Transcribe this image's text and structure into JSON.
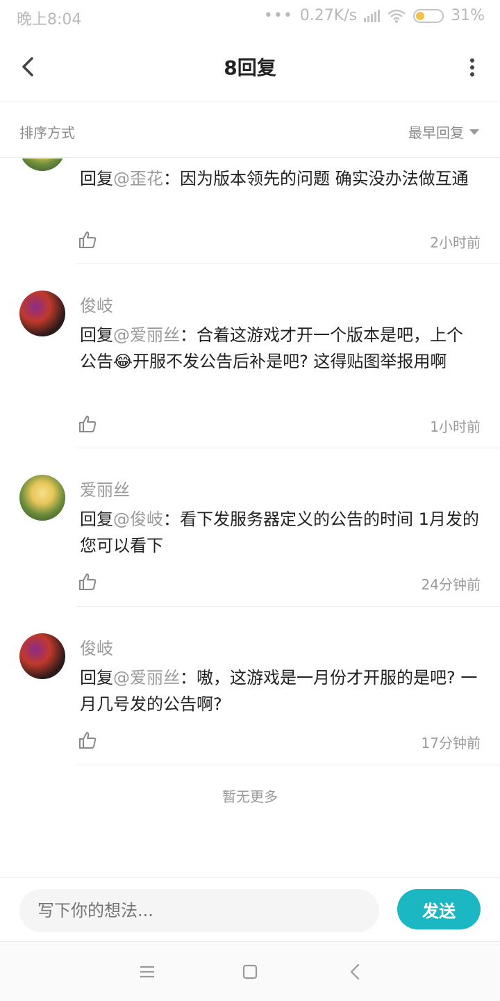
{
  "status_bar": {
    "time": "晚上8:04",
    "network_speed": "0.27K/s",
    "battery_percent": "31%",
    "battery_level": 0.31,
    "icons": [
      "dots-icon",
      "signal-icon",
      "wifi-icon",
      "battery-icon"
    ]
  },
  "header": {
    "title": "8回复",
    "back_icon": "chevron-left-icon",
    "more_icon": "more-vertical-icon"
  },
  "sort": {
    "label": "排序方式",
    "selected": "最早回复"
  },
  "comments": [
    {
      "user": "",
      "avatar": "girl",
      "reply_prefix": "回复",
      "mention": "@歪花",
      "text": "：因为版本领先的问题 确实没办法做互通",
      "time": "2小时前"
    },
    {
      "user": "俊岐",
      "avatar": "dog",
      "reply_prefix": "回复",
      "mention": "@爱丽丝",
      "text": "：合着这游戏才开一个版本是吧，上个公告😂开服不发公告后补是吧? 这得贴图举报用啊",
      "time": "1小时前"
    },
    {
      "user": "爱丽丝",
      "avatar": "girl",
      "reply_prefix": "回复",
      "mention": "@俊岐",
      "text": "：看下发服务器定义的公告的时间 1月发的 您可以看下",
      "time": "24分钟前"
    },
    {
      "user": "俊岐",
      "avatar": "dog",
      "reply_prefix": "回复",
      "mention": "@爱丽丝",
      "text": "：嗷，这游戏是一月份才开服的是吧? 一月几号发的公告啊?",
      "time": "17分钟前"
    }
  ],
  "end_text": "暂无更多",
  "compose": {
    "placeholder": "写下你的想法...",
    "send_label": "发送"
  },
  "colors": {
    "accent": "#1bb8c4",
    "muted": "#9a9a9a",
    "text": "#222222"
  }
}
